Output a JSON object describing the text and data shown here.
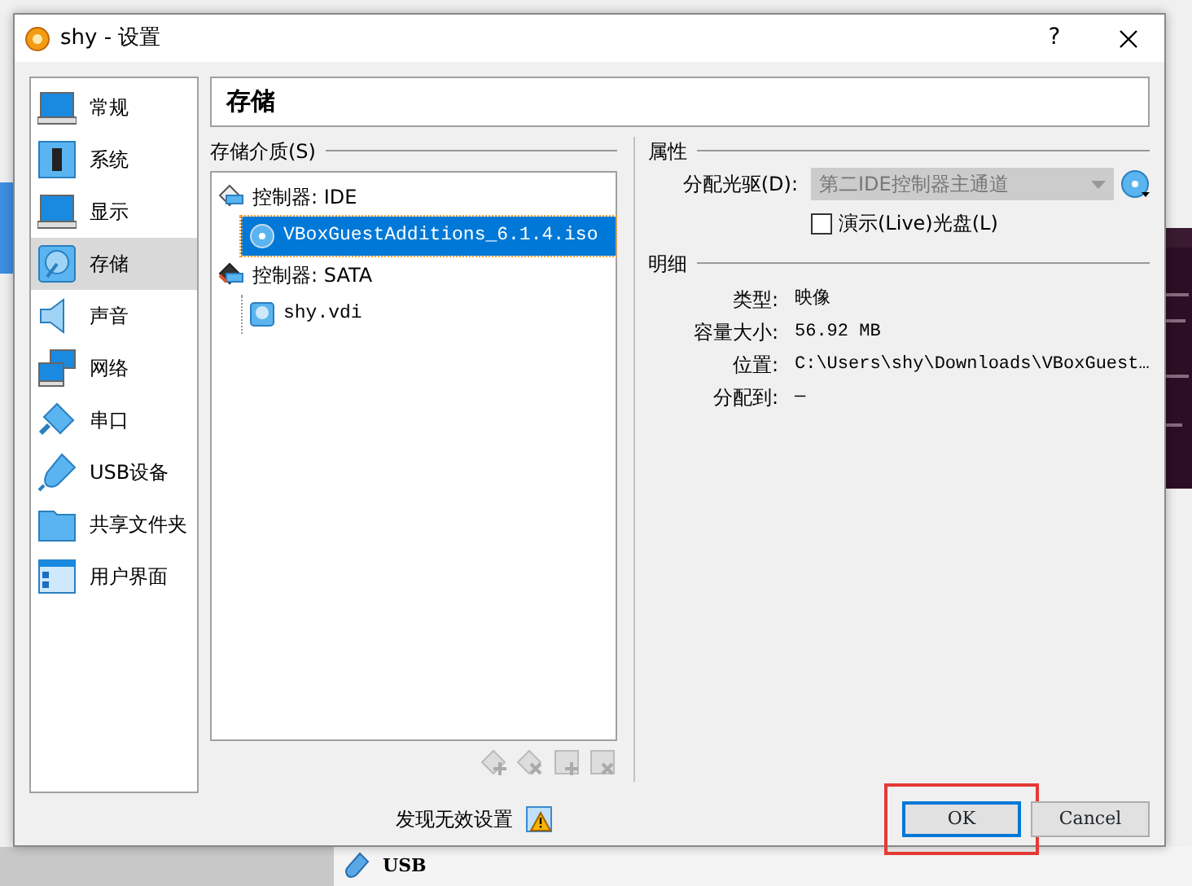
{
  "background": {
    "bottom_item": "USB"
  },
  "window": {
    "title": "shy - 设置",
    "help": "?"
  },
  "sidebar": {
    "items": [
      {
        "label": "常规",
        "kind": "general",
        "selected": false
      },
      {
        "label": "系统",
        "kind": "system",
        "selected": false
      },
      {
        "label": "显示",
        "kind": "display",
        "selected": false
      },
      {
        "label": "存储",
        "kind": "storage",
        "selected": true
      },
      {
        "label": "声音",
        "kind": "audio",
        "selected": false
      },
      {
        "label": "网络",
        "kind": "network",
        "selected": false
      },
      {
        "label": "串口",
        "kind": "serial",
        "selected": false
      },
      {
        "label": "USB设备",
        "kind": "usb",
        "selected": false
      },
      {
        "label": "共享文件夹",
        "kind": "folder",
        "selected": false
      },
      {
        "label": "用户界面",
        "kind": "ui",
        "selected": false
      }
    ]
  },
  "header": "存储",
  "storage": {
    "label": "存储介质(S)",
    "tree": [
      {
        "label": "控制器: IDE",
        "kind": "controller",
        "selected": false,
        "children": [
          {
            "label": "VBoxGuestAdditions_6.1.4.iso",
            "kind": "optical",
            "selected": true
          }
        ]
      },
      {
        "label": "控制器: SATA",
        "kind": "controller_sata",
        "selected": false,
        "children": [
          {
            "label": "shy.vdi",
            "kind": "disk",
            "selected": false
          }
        ]
      }
    ]
  },
  "attributes": {
    "title": "属性",
    "drive_label": "分配光驱(D):",
    "drive_value": "第二IDE控制器主通道",
    "drive_disabled": true,
    "live_label": "演示(Live)光盘(L)",
    "live_checked": false
  },
  "details": {
    "title": "明细",
    "rows": [
      {
        "label": "类型:",
        "value": "映像"
      },
      {
        "label": "容量大小:",
        "value": "56.92  MB"
      },
      {
        "label": "位置:",
        "value": "C:\\Users\\shy\\Downloads\\VBoxGuest…"
      },
      {
        "label": "分配到:",
        "value": "—"
      }
    ]
  },
  "status": {
    "text": "发现无效设置"
  },
  "buttons": [
    {
      "label": "OK",
      "default": true,
      "highlighted": true
    },
    {
      "label": "Cancel",
      "default": false,
      "highlighted": false
    }
  ]
}
